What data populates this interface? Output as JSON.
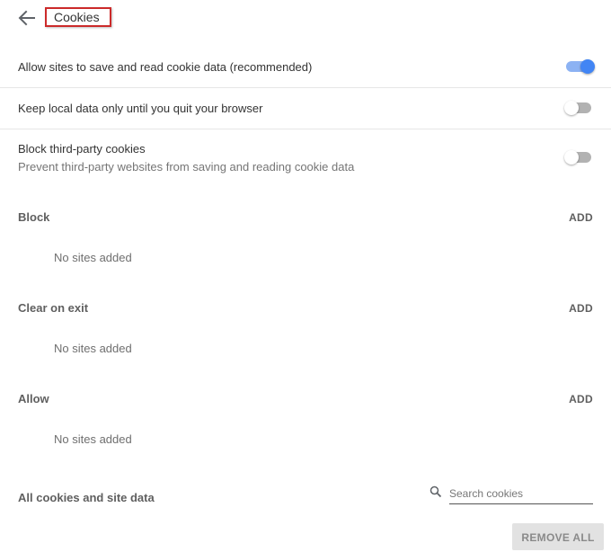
{
  "header": {
    "back_icon": "arrow-left-icon",
    "title": "Cookies"
  },
  "settings": [
    {
      "label": "Allow sites to save and read cookie data (recommended)",
      "enabled": true
    },
    {
      "label": "Keep local data only until you quit your browser",
      "enabled": false
    },
    {
      "label": "Block third-party cookies",
      "sublabel": "Prevent third-party websites from saving and reading cookie data",
      "enabled": false
    }
  ],
  "sections": [
    {
      "title": "Block",
      "add_label": "ADD",
      "empty_text": "No sites added"
    },
    {
      "title": "Clear on exit",
      "add_label": "ADD",
      "empty_text": "No sites added"
    },
    {
      "title": "Allow",
      "add_label": "ADD",
      "empty_text": "No sites added"
    }
  ],
  "all_cookies": {
    "title": "All cookies and site data",
    "search_icon": "search-icon",
    "search_placeholder": "Search cookies",
    "search_value": "",
    "remove_all_label": "REMOVE ALL"
  },
  "colors": {
    "accent": "#4285f4",
    "highlight_border": "#cc2a2a"
  }
}
